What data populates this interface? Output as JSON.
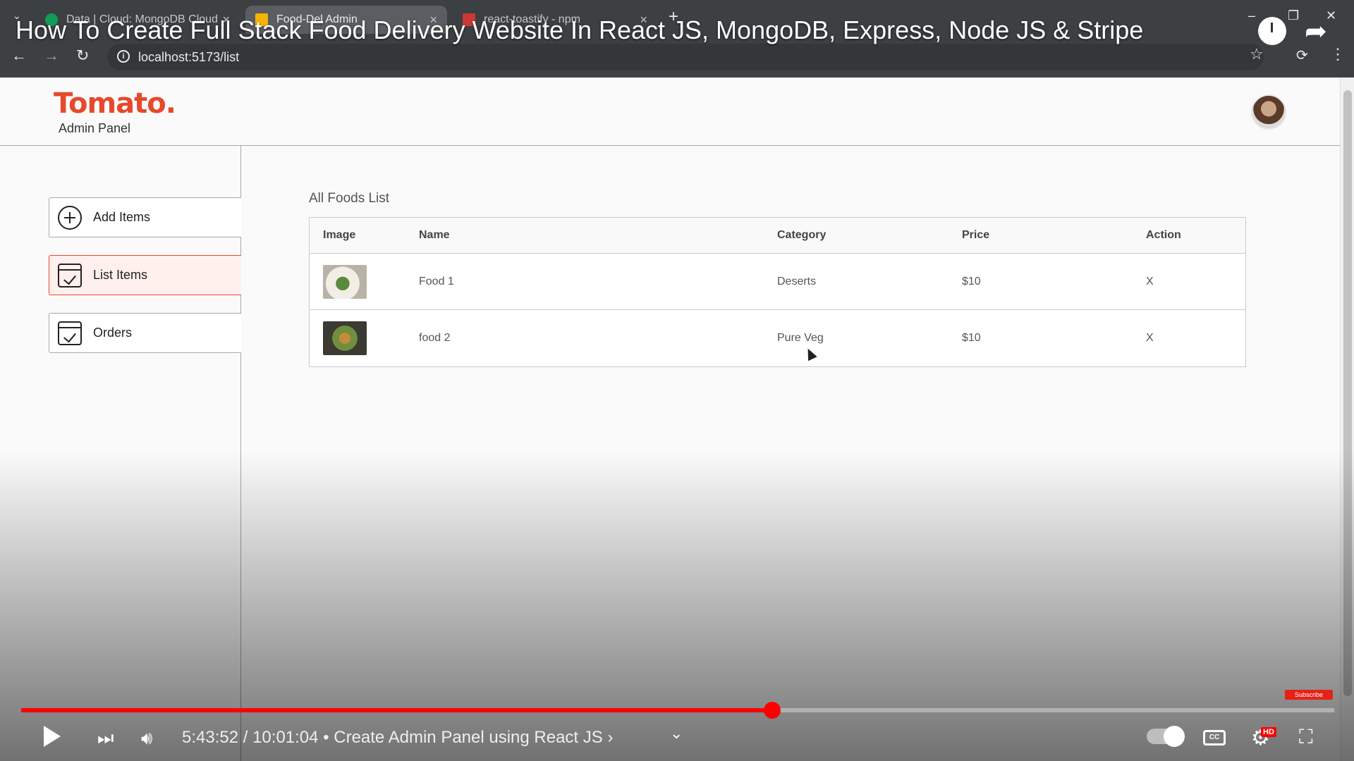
{
  "browser": {
    "tabs": [
      {
        "title": "Data | Cloud: MongoDB Cloud",
        "favicon_color": "#0f9d58"
      },
      {
        "title": "Food-Del Admin",
        "favicon_color": "#f4b400"
      },
      {
        "title": "react-toastify - npm",
        "favicon_color": "#cb3837"
      }
    ],
    "url": "localhost:5173/list"
  },
  "video": {
    "title": "How To Create Full Stack Food Delivery Website In React JS, MongoDB, Express, Node JS & Stripe",
    "time": "5:43:52 / 10:01:04 • Create Admin Panel using React JS ›",
    "progress_fraction": 0.572,
    "subscribe_label": "Subscribe",
    "hd_badge": "HD",
    "cc_label": "CC"
  },
  "app": {
    "brand": "Tomato.",
    "subtitle": "Admin Panel",
    "accent_color": "#e8482b",
    "sidebar": [
      {
        "label": "Add Items",
        "icon": "add-circle-icon"
      },
      {
        "label": "List Items",
        "icon": "checklist-icon",
        "active": true
      },
      {
        "label": "Orders",
        "icon": "checklist-icon"
      }
    ],
    "list": {
      "title": "All Foods List",
      "headers": [
        "Image",
        "Name",
        "Category",
        "Price",
        "Action"
      ],
      "rows": [
        {
          "name": "Food 1",
          "category": "Deserts",
          "price": "$10",
          "action": "X"
        },
        {
          "name": "food 2",
          "category": "Pure Veg",
          "price": "$10",
          "action": "X"
        }
      ]
    }
  }
}
